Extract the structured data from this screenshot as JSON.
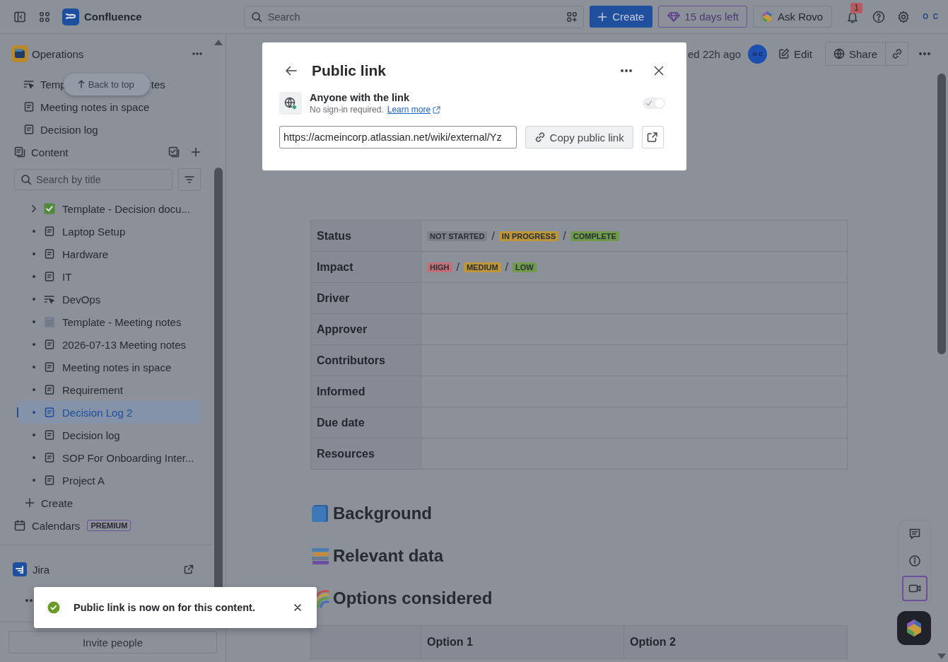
{
  "topbar": {
    "product": "Confluence",
    "search_placeholder": "Search",
    "create": "Create",
    "trial": "15 days left",
    "ask": "Ask Rovo",
    "notifications": "1",
    "account_logo": "O C"
  },
  "sidebar": {
    "back_to_top": "Back to top",
    "space": "Operations",
    "shortcuts": [
      {
        "kind": "template",
        "label": "Temp",
        "label_tail": "tes"
      },
      {
        "kind": "page",
        "label": "Meeting notes in space"
      },
      {
        "kind": "page",
        "label": "Decision log"
      }
    ],
    "content_label": "Content",
    "search_placeholder": "Search by title",
    "tree": [
      {
        "kind": "check",
        "label": "Template - Decision docu...",
        "has_children": true,
        "selected": false
      },
      {
        "kind": "page",
        "label": "Laptop Setup",
        "has_children": false,
        "selected": false
      },
      {
        "kind": "page",
        "label": "Hardware",
        "has_children": false,
        "selected": false
      },
      {
        "kind": "page",
        "label": "IT",
        "has_children": false,
        "selected": false
      },
      {
        "kind": "template",
        "label": "DevOps",
        "has_children": false,
        "selected": false
      },
      {
        "kind": "notepad",
        "label": "Template - Meeting notes",
        "has_children": false,
        "selected": false
      },
      {
        "kind": "page",
        "label": "2026-07-13 Meeting notes",
        "has_children": false,
        "selected": false
      },
      {
        "kind": "page",
        "label": "Meeting notes in space",
        "has_children": false,
        "selected": false
      },
      {
        "kind": "page",
        "label": "Requirement",
        "has_children": false,
        "selected": false
      },
      {
        "kind": "page",
        "label": "Decision Log 2",
        "has_children": false,
        "selected": true
      },
      {
        "kind": "page",
        "label": "Decision log",
        "has_children": false,
        "selected": false
      },
      {
        "kind": "page",
        "label": "SOP For Onboarding Inter...",
        "has_children": false,
        "selected": false
      },
      {
        "kind": "page",
        "label": "Project A",
        "has_children": false,
        "selected": false
      }
    ],
    "create": "Create",
    "calendars": "Calendars",
    "calendars_badge": "PREMIUM",
    "jira": "Jira",
    "invite": "Invite people"
  },
  "page_header": {
    "modified": "ed 22h ago",
    "avatar": "O C",
    "edit": "Edit",
    "share": "Share"
  },
  "decision_table": [
    {
      "label": "Status",
      "tags": [
        {
          "text": "NOT STARTED",
          "color": "#7c818b"
        },
        {
          "text": "IN PROGRESS",
          "color": "#bd963a"
        },
        {
          "text": "COMPLETE",
          "color": "#6e9a4a"
        }
      ]
    },
    {
      "label": "Impact",
      "tags": [
        {
          "text": "HIGH",
          "color": "#c2717a"
        },
        {
          "text": "MEDIUM",
          "color": "#bd963a"
        },
        {
          "text": "LOW",
          "color": "#6e9a4a"
        }
      ]
    },
    {
      "label": "Driver"
    },
    {
      "label": "Approver"
    },
    {
      "label": "Contributors"
    },
    {
      "label": "Informed"
    },
    {
      "label": "Due date"
    },
    {
      "label": "Resources"
    }
  ],
  "tag_separator": "/",
  "headings": [
    {
      "kind": "book",
      "text": "Background"
    },
    {
      "kind": "books",
      "text": "Relevant data"
    },
    {
      "kind": "rainbow",
      "text": "Options considered"
    }
  ],
  "options_table": {
    "columns": [
      "Option 1",
      "Option 2"
    ]
  },
  "modal": {
    "title": "Public link",
    "access_title": "Anyone with the link",
    "access_note": "No sign-in required.",
    "learn_more": "Learn more",
    "toggle_on": true,
    "url": "https://acmeincorp.atlassian.net/wiki/external/Yz",
    "copy": "Copy public link"
  },
  "toast": {
    "message": "Public link is now on for this content."
  }
}
